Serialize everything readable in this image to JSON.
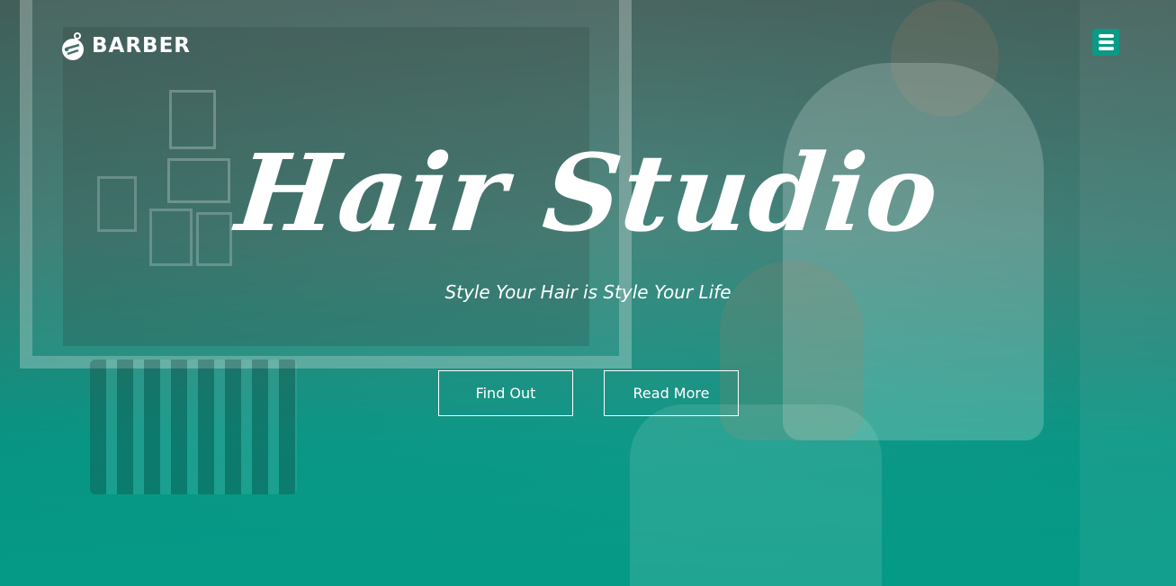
{
  "header": {
    "brand_name": "BARBER",
    "logo_icon": "scissors-head-icon",
    "menu_icon": "hamburger-menu-icon"
  },
  "hero": {
    "title": "Hair Studio",
    "subtitle": "Style Your Hair is Style Your Life",
    "buttons": [
      {
        "label": "Find Out"
      },
      {
        "label": "Read More"
      }
    ]
  },
  "colors": {
    "accent": "#0a9a86",
    "text": "#ffffff"
  }
}
